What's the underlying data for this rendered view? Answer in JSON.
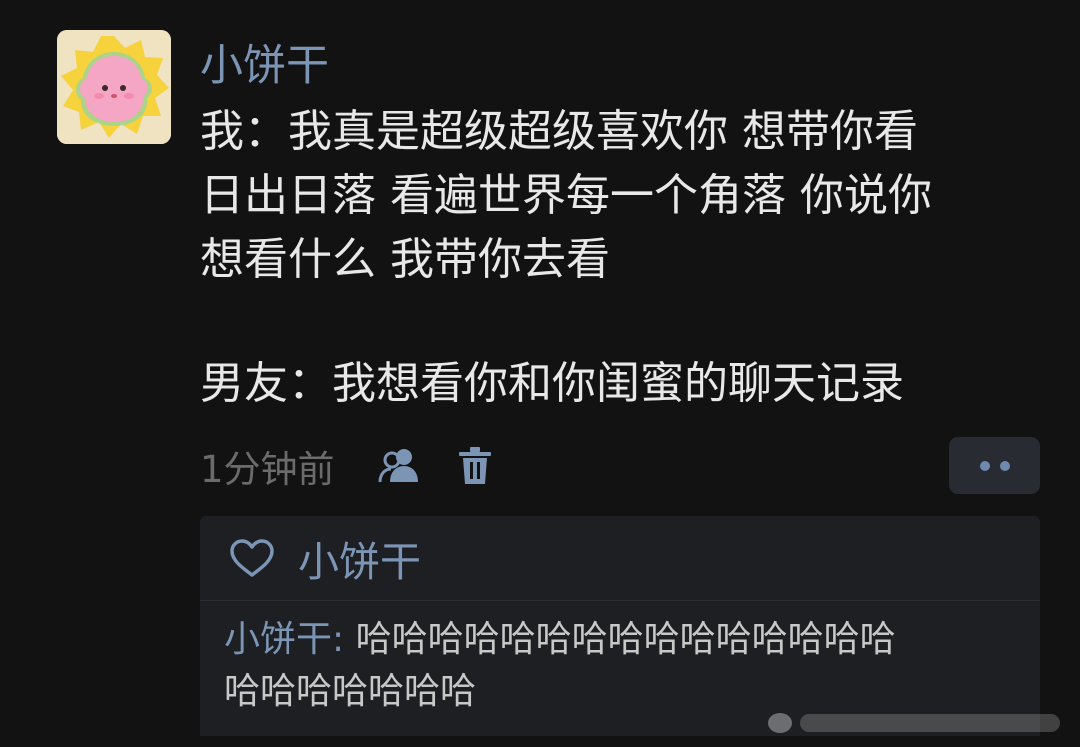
{
  "post": {
    "username": "小饼干",
    "message_lines": [
      "我：我真是超级超级喜欢你 想带你看",
      "日出日落 看遍世界每一个角落 你说你",
      "想看什么 我带你去看",
      "男友：我想看你和你闺蜜的聊天记录"
    ],
    "timestamp": "1分钟前",
    "icons": {
      "visibility": "people-icon",
      "delete": "trash-icon",
      "more": "more-dots-icon",
      "like": "heart-icon"
    }
  },
  "likes": {
    "liker_name": "小饼干"
  },
  "reply": {
    "author": "小饼干",
    "separator": ": ",
    "text_line1": "哈哈哈哈哈哈哈哈哈哈哈哈哈哈哈",
    "text_line2": "哈哈哈哈哈哈哈"
  },
  "colors": {
    "background": "#121212",
    "name_blue": "#7c95b5",
    "message_text": "#e8e8e8",
    "meta_gray": "#6b6b6b",
    "comment_bg": "#1d1f23"
  }
}
